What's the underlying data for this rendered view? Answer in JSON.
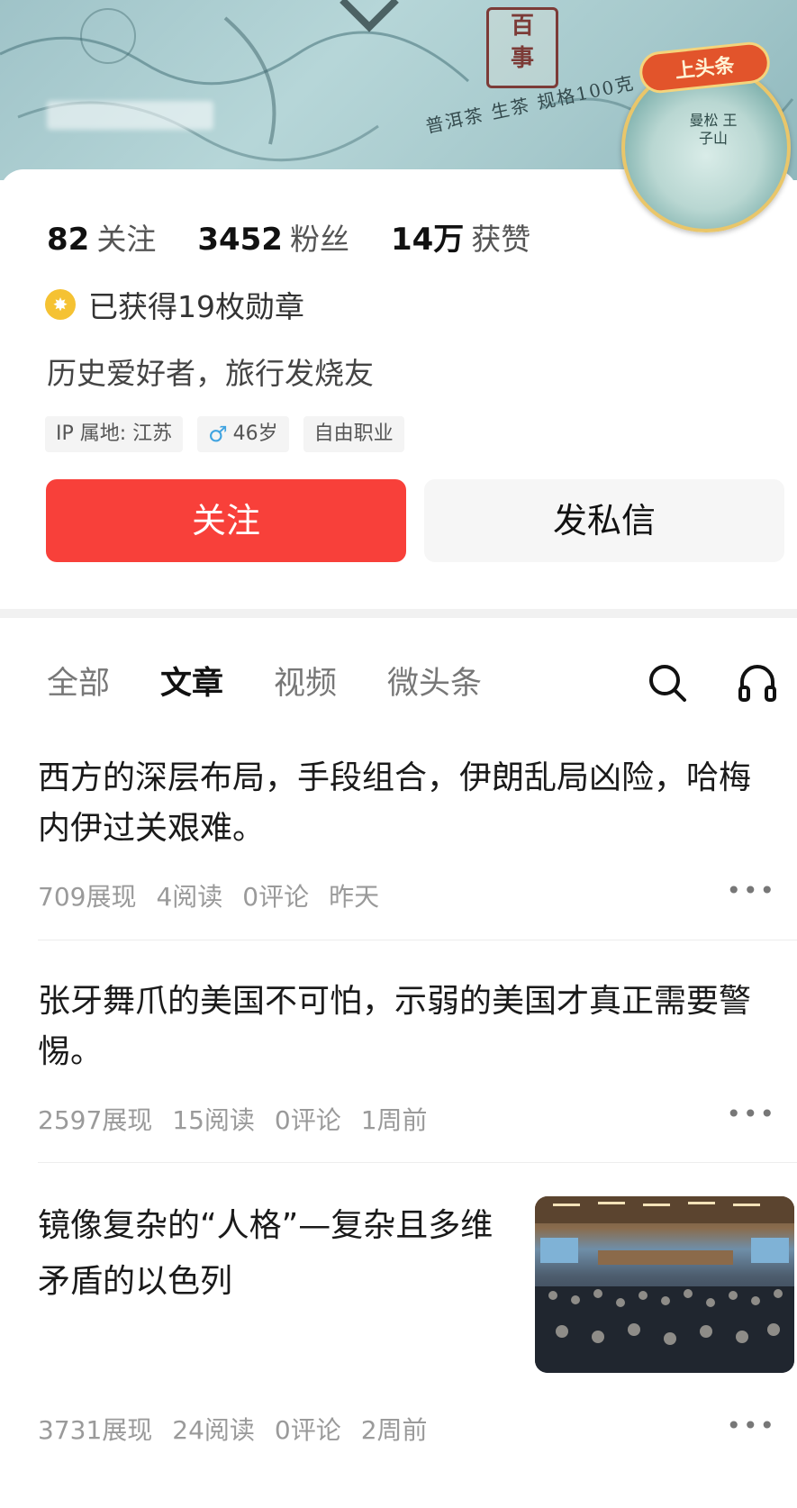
{
  "banner": {
    "seal_text": [
      "百",
      "事"
    ],
    "tea_text": "普洱茶 生茶 规格100克",
    "avatar_ribbon": "上头条",
    "avatar_tea_label": "曼松 王子山"
  },
  "stats": [
    {
      "num": "82",
      "label": "关注"
    },
    {
      "num": "3452",
      "label": "粉丝"
    },
    {
      "num": "14万",
      "label": "获赞"
    }
  ],
  "medal_text": "已获得19枚勋章",
  "bio": "历史爱好者，旅行发烧友",
  "tags": {
    "ip": "IP 属地: 江苏",
    "age": "46岁",
    "job": "自由职业"
  },
  "buttons": {
    "follow": "关注",
    "message": "发私信"
  },
  "tabs": [
    "全部",
    "文章",
    "视频",
    "微头条"
  ],
  "active_tab": "文章",
  "icons": {
    "search": "search-icon",
    "listen": "headphones-icon",
    "more": "more-icon"
  },
  "articles": [
    {
      "title": "西方的深层布局，手段组合，伊朗乱局凶险，哈梅内伊过关艰难。",
      "views": "709展现",
      "reads": "4阅读",
      "comments": "0评论",
      "time": "昨天"
    },
    {
      "title": "张牙舞爪的美国不可怕，示弱的美国才真正需要警惕。",
      "views": "2597展现",
      "reads": "15阅读",
      "comments": "0评论",
      "time": "1周前"
    },
    {
      "title": "镜像复杂的“人格”—复杂且多维矛盾的以色列",
      "views": "3731展现",
      "reads": "24阅读",
      "comments": "0评论",
      "time": "2周前"
    }
  ],
  "colors": {
    "follow_red": "#f8403a",
    "medal_gold": "#f5c233"
  }
}
